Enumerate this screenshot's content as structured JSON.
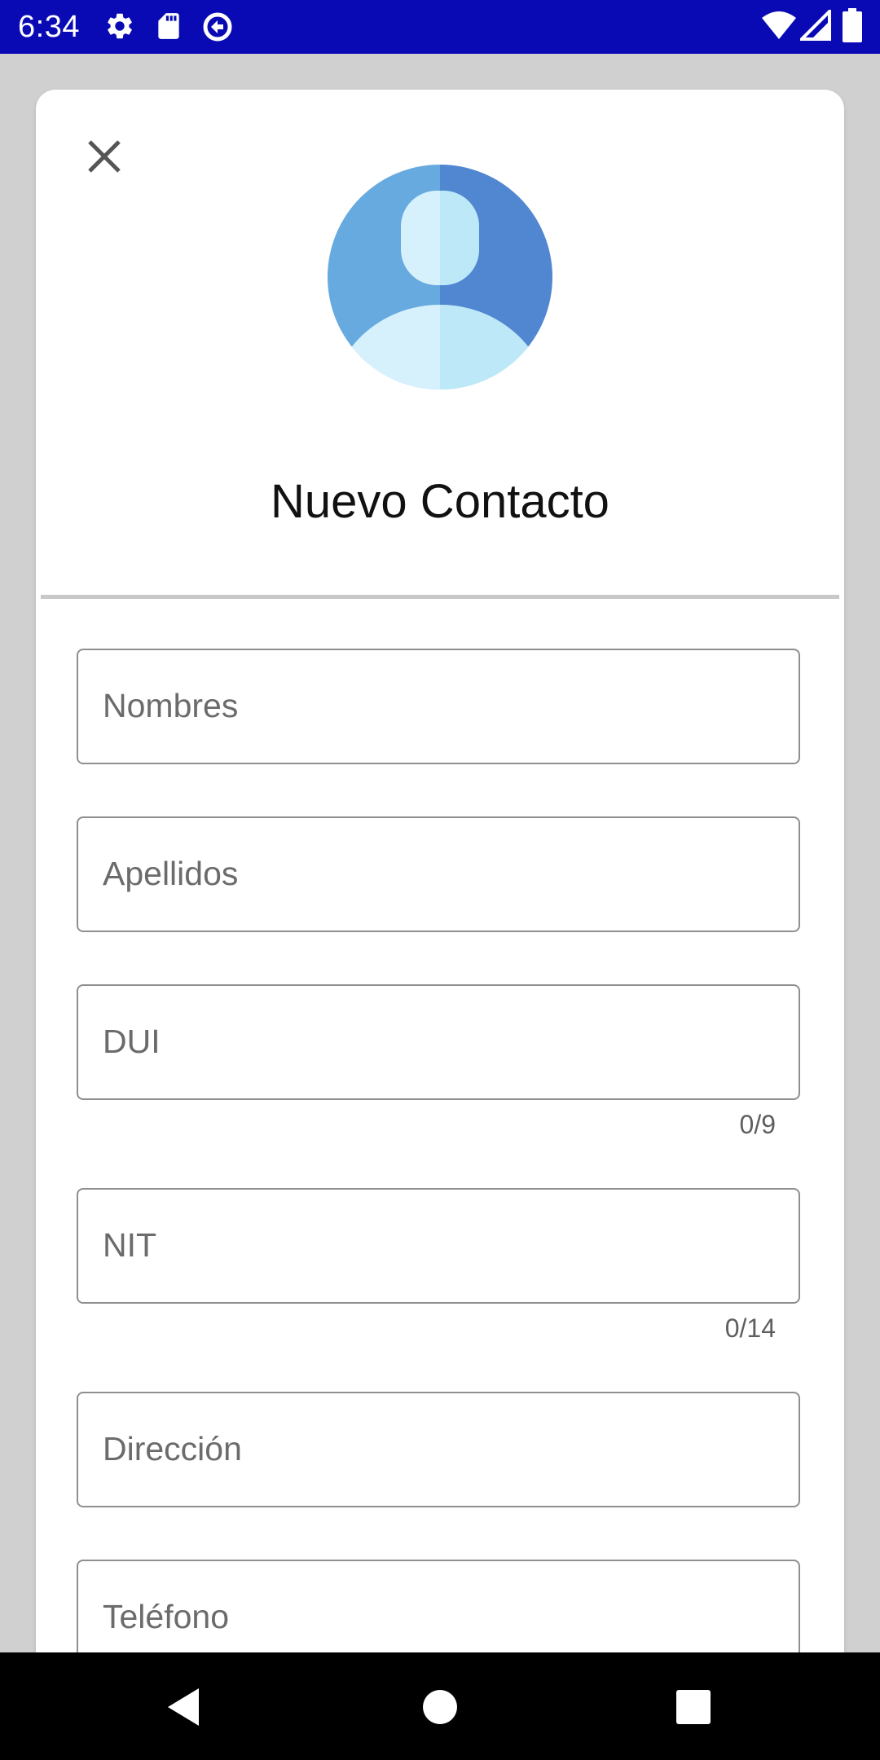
{
  "status_bar": {
    "time": "6:34",
    "left_icons": [
      "settings-icon",
      "sd-card-icon",
      "data-saver-icon"
    ],
    "right_icons": [
      "wifi-icon",
      "cell-signal-icon",
      "battery-icon"
    ]
  },
  "dialog": {
    "close_icon": "close-icon",
    "avatar_icon": "person-avatar-icon",
    "title": "Nuevo Contacto",
    "fields": [
      {
        "id": "nombres",
        "placeholder": "Nombres",
        "value": ""
      },
      {
        "id": "apellidos",
        "placeholder": "Apellidos",
        "value": ""
      },
      {
        "id": "dui",
        "placeholder": "DUI",
        "value": "",
        "counter": "0/9"
      },
      {
        "id": "nit",
        "placeholder": "NIT",
        "value": "",
        "counter": "0/14"
      },
      {
        "id": "direccion",
        "placeholder": "Dirección",
        "value": ""
      },
      {
        "id": "telefono",
        "placeholder": "Teléfono",
        "value": ""
      }
    ]
  },
  "nav_bar": {
    "buttons": [
      "back-icon",
      "home-icon",
      "recents-icon"
    ]
  },
  "colors": {
    "status_bar": "#0a0ab4",
    "avatar_light": "#67aadf",
    "avatar_dark": "#5087d0",
    "avatar_figure_light": "#d6f1fc",
    "avatar_figure_dark": "#bde8f8"
  }
}
